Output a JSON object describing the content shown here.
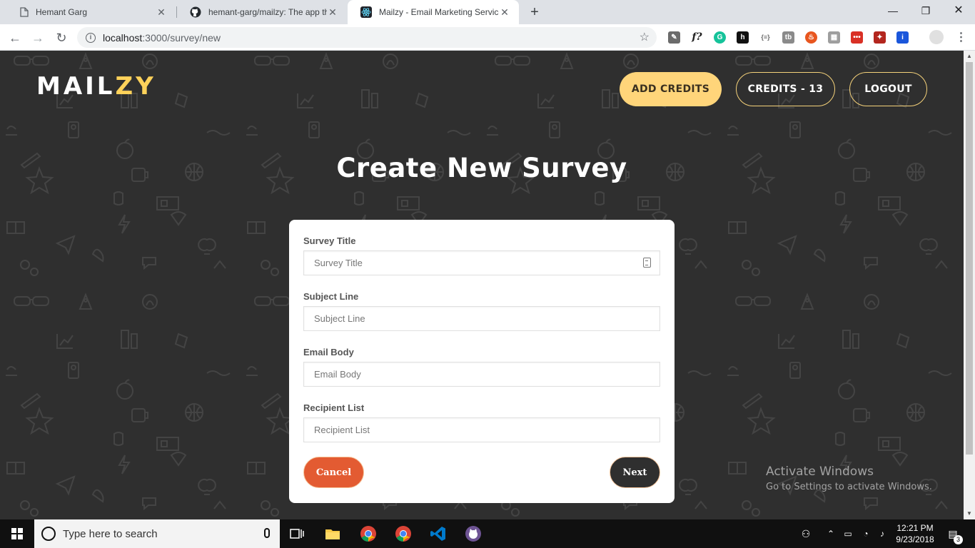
{
  "browser": {
    "tabs": [
      {
        "title": "Hemant Garg",
        "active": false
      },
      {
        "title": "hemant-garg/mailzy: The app tha",
        "active": false
      },
      {
        "title": "Mailzy - Email Marketing Service",
        "active": true
      }
    ],
    "url_host": "localhost",
    "url_path": ":3000/survey/new"
  },
  "header": {
    "logo_main": "MAIL",
    "logo_accent": "ZY",
    "add_credits": "ADD CREDITS",
    "credits": "CREDITS - 13",
    "logout": "LOGOUT"
  },
  "page": {
    "title": "Create New Survey"
  },
  "form": {
    "survey_title": {
      "label": "Survey Title",
      "placeholder": "Survey Title",
      "value": ""
    },
    "subject_line": {
      "label": "Subject Line",
      "placeholder": "Subject Line",
      "value": ""
    },
    "email_body": {
      "label": "Email Body",
      "placeholder": "Email Body",
      "value": ""
    },
    "recipient_list": {
      "label": "Recipient List",
      "placeholder": "Recipient List",
      "value": ""
    },
    "cancel": "Cancel",
    "next": "Next"
  },
  "watermark": {
    "line1": "Activate Windows",
    "line2": "Go to Settings to activate Windows."
  },
  "taskbar": {
    "search_placeholder": "Type here to search",
    "time": "12:21 PM",
    "date": "9/23/2018",
    "notification_count": "3"
  },
  "colors": {
    "accent_yellow": "#ffd25a",
    "cancel_orange": "#e35b32",
    "background": "#2f2f2f"
  }
}
